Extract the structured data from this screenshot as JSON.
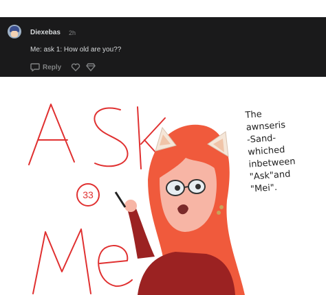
{
  "comment": {
    "username": "Diexebas",
    "age": "2h",
    "text": "Me: ask 1: How old are you??",
    "actions": {
      "reply_label": "Reply",
      "reply_icon": "speech-bubble-icon",
      "like_icon": "heart-icon",
      "award_icon": "award-icon"
    }
  },
  "drawing": {
    "ask_text": "ASK",
    "me_text": "Me",
    "age_badge": "33",
    "side_note": "The\nawnseris\n-Sand-\nwhiched\ninbetween\n\"Ask\"and\n\"Mei\"."
  },
  "colors": {
    "comment_bg": "#1a1a1b",
    "accent_red": "#e03030",
    "hair": "#f05a3c",
    "shirt": "#9b2222"
  }
}
